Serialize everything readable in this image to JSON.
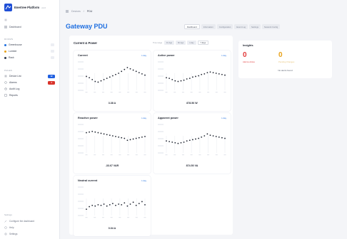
{
  "brand": {
    "name": "Enertree Platform",
    "version": "v1.0"
  },
  "sidebar": {
    "top_link": "Dashboard",
    "section1": "Rooms",
    "rooms": [
      {
        "label": "Greenhouse",
        "dot": "#1f6fe0",
        "icon": "chevron-icon"
      },
      {
        "label": "Lumber",
        "dot": "#e8a21a",
        "icon": "chevron-icon"
      },
      {
        "label": "Rack",
        "dot": "#2f3a4d",
        "icon": "chevron-icon"
      }
    ],
    "section2": "Pages",
    "pages": [
      {
        "label": "Device List",
        "badge": "12",
        "badge_color": "#1f5fe0"
      },
      {
        "label": "Alarms",
        "badge": "4",
        "badge_color": "#d9342b"
      },
      {
        "label": "Audit Log",
        "badge": ""
      },
      {
        "label": "Reports",
        "badge": ""
      }
    ],
    "footer_section": "Settings",
    "footer": [
      {
        "label": "Configure the dashboard"
      },
      {
        "label": "Help"
      },
      {
        "label": "Settings"
      }
    ]
  },
  "breadcrumb": {
    "root": "Devices",
    "current": "PDU"
  },
  "page_title": "Gateway PDU",
  "tabs": [
    {
      "label": "Dashboard",
      "active": true
    },
    {
      "label": "Information",
      "active": false
    },
    {
      "label": "Configuration",
      "active": false
    },
    {
      "label": "Event Log",
      "active": false
    },
    {
      "label": "Settings",
      "active": false
    },
    {
      "label": "Network Config",
      "active": false
    }
  ],
  "panel": {
    "title": "Current & Power",
    "range_label": "Time range",
    "ranges": [
      {
        "label": "1h Ago",
        "active": false
      },
      {
        "label": "6h Ago",
        "active": false
      },
      {
        "label": "1 day",
        "active": false
      },
      {
        "label": "7 days",
        "active": true
      }
    ]
  },
  "cards": [
    {
      "title": "Current",
      "link": "1 day",
      "value": "3.38 A",
      "color": "#1f2430",
      "chart_data": {
        "type": "line",
        "values": [
          52,
          50,
          47,
          44,
          43,
          45,
          47,
          49,
          51,
          53,
          55,
          57,
          60,
          63,
          66,
          64,
          62,
          60,
          58,
          56,
          54
        ]
      }
    },
    {
      "title": "Active power",
      "link": "1 day",
      "value": "878.56 W",
      "color": "#1f2430",
      "chart_data": {
        "type": "line",
        "values": [
          50,
          49,
          47,
          45,
          44,
          45,
          46,
          48,
          49,
          51,
          52,
          53,
          55,
          56,
          58,
          59,
          58,
          57,
          56,
          55,
          54
        ]
      }
    },
    {
      "title": "Reactive power",
      "link": "1 day",
      "value": "-33.67 VAR",
      "color": "#1f2430",
      "chart_data": {
        "type": "line",
        "values": [
          62,
          63,
          64,
          63,
          62,
          61,
          60,
          59,
          58,
          57,
          56,
          55,
          54,
          53,
          50,
          51,
          52,
          53,
          54,
          55,
          56
        ]
      }
    },
    {
      "title": "Apparent power",
      "link": "1 day",
      "value": "874.50 VA",
      "color": "#1f2430",
      "chart_data": {
        "type": "line",
        "values": [
          49,
          48,
          47,
          46,
          45,
          46,
          47,
          49,
          50,
          51,
          52,
          53,
          55,
          57,
          60,
          58,
          57,
          56,
          55,
          54,
          53
        ]
      }
    },
    {
      "title": "Neutral current",
      "link": "1 day",
      "value": "0.04 A",
      "color": "#1f2430",
      "chart_data": {
        "type": "scatter",
        "values": [
          40,
          44,
          46,
          45,
          47,
          46,
          48,
          45,
          47,
          49,
          46,
          48,
          47,
          50,
          45,
          48,
          51,
          46,
          49,
          52,
          47
        ]
      }
    }
  ],
  "insights": {
    "title": "Insights",
    "stat1": {
      "value": "0",
      "label": "Alarms Active",
      "color": "#e23b3b"
    },
    "stat2": {
      "value": "0",
      "label": "Pending Changes",
      "color": "#e8a21a"
    },
    "empty": "No alerts found"
  }
}
